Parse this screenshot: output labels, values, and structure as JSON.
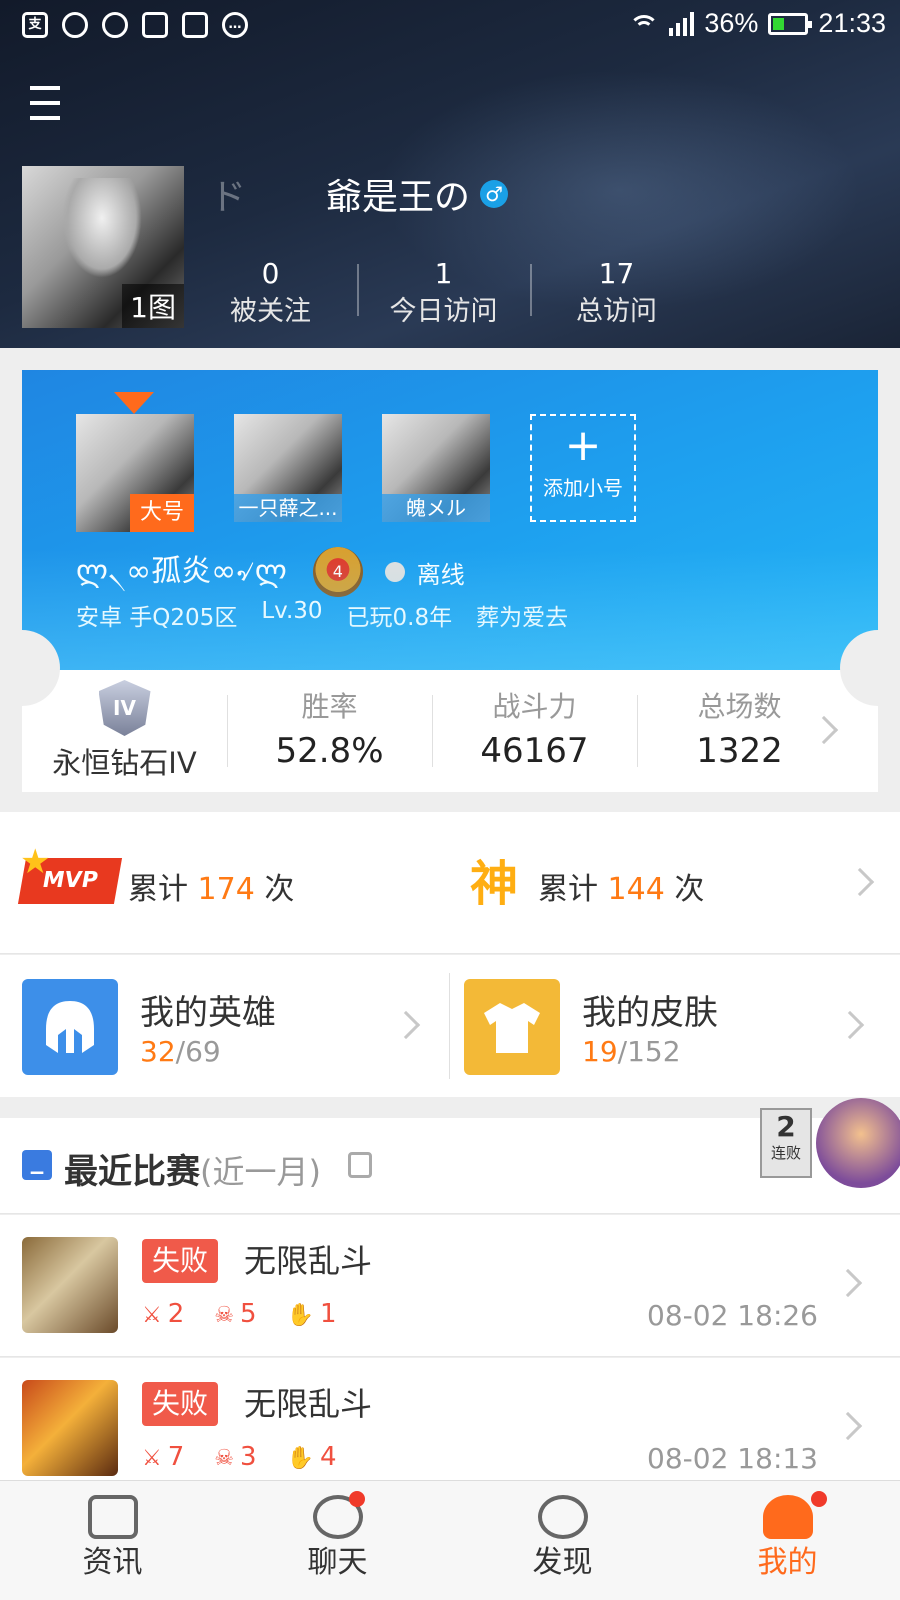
{
  "status_bar": {
    "left_icons": [
      "app-icon",
      "q-icon",
      "qq-icon",
      "image-icon",
      "grid-icon",
      "more-icon"
    ],
    "battery": "36%",
    "battery_level": 0.36,
    "time": "21:33"
  },
  "profile": {
    "name_prefix": "ド",
    "name": "爺是王の",
    "gender_symbol": "♂",
    "photo_count": "1图",
    "stats": [
      {
        "value": "0",
        "label": "被关注"
      },
      {
        "value": "1",
        "label": "今日访问"
      },
      {
        "value": "17",
        "label": "总访问"
      }
    ]
  },
  "accounts": {
    "main_tag": "大号",
    "subs": [
      "一只薛之...",
      "魄メル"
    ],
    "add_plus": "+",
    "add_label": "添加小号"
  },
  "role": {
    "name": "ლ৲∞孤炎∞৵ლ",
    "rank_level": "4",
    "online_status": "离线",
    "platform": "安卓 手Q205区",
    "level": "Lv.30",
    "played": "已玩0.8年",
    "clan": "葬为爱去"
  },
  "rank_stats": {
    "tier_badge": "IV",
    "tier_name": "永恒钻石IV",
    "items": [
      {
        "label": "胜率",
        "value": "52.8%"
      },
      {
        "label": "战斗力",
        "value": "46167"
      },
      {
        "label": "总场数",
        "value": "1322"
      }
    ]
  },
  "awards": {
    "mvp_badge": "MVP",
    "mvp_prefix": "累计",
    "mvp_count": "174",
    "mvp_suffix": "次",
    "god_badge": "神",
    "god_prefix": "累计",
    "god_count": "144",
    "god_suffix": "次"
  },
  "collections": {
    "heroes_title": "我的英雄",
    "heroes_owned": "32",
    "heroes_total": "69",
    "skins_title": "我的皮肤",
    "skins_owned": "19",
    "skins_total": "152"
  },
  "recent": {
    "title": "最近比赛",
    "subtitle": "(近一月)",
    "streak_num": "2",
    "streak_label": "连败",
    "matches": [
      {
        "result": "失败",
        "mode": "无限乱斗",
        "kills": "2",
        "deaths": "5",
        "assists": "1",
        "time": "08-02 18:26"
      },
      {
        "result": "失败",
        "mode": "无限乱斗",
        "kills": "7",
        "deaths": "3",
        "assists": "4",
        "time": "08-02 18:13"
      }
    ]
  },
  "tabs": [
    {
      "label": "资讯"
    },
    {
      "label": "聊天"
    },
    {
      "label": "发现"
    },
    {
      "label": "我的"
    }
  ],
  "colors": {
    "accent": "#ff6a1c",
    "card_blue": "#1ea0ef",
    "lose_red": "#f05a4a"
  }
}
